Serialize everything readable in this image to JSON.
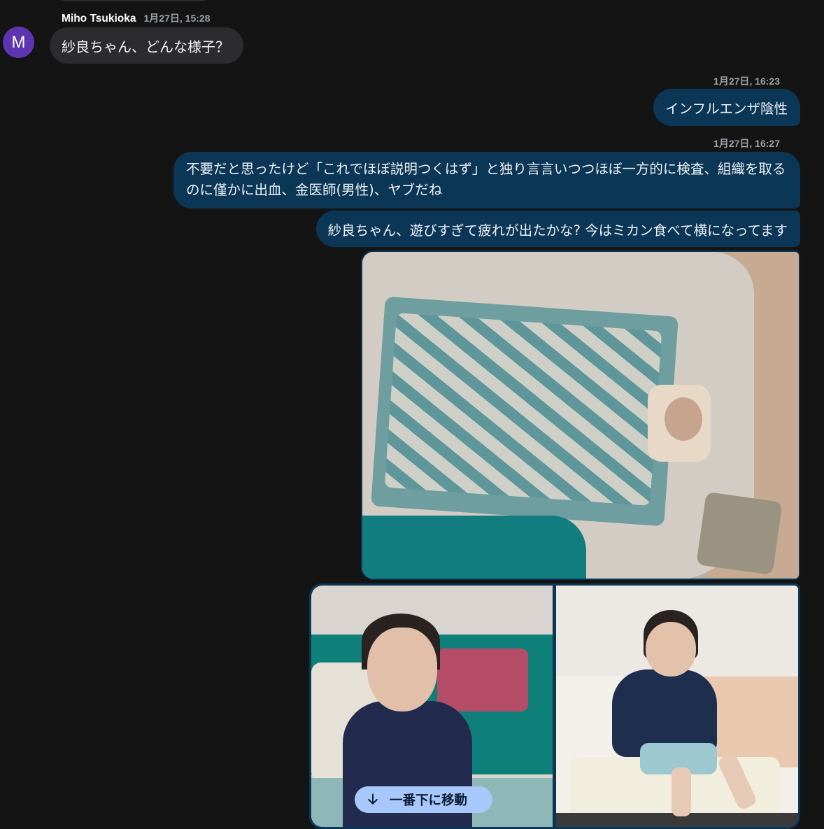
{
  "incoming": {
    "avatar_letter": "M",
    "sender": "Miho Tsukioka",
    "time": "1月27日, 15:28",
    "text": "紗良ちゃん、どんな様子？"
  },
  "outgoing": [
    {
      "time": "1月27日, 16:23",
      "text": "インフルエンザ陰性"
    },
    {
      "time": "1月27日, 16:27",
      "text": "不要だと思ったけど「これでほぼ説明つくはず」と独り言言いつつほぼ一方的に検査、組織を取るのに僅かに出血、金医師(男性)、ヤブだね"
    },
    {
      "text": "紗良ちゃん、遊びすぎて疲れが出たかな? 今はミカン食べて横になってます"
    }
  ],
  "images": [
    {
      "name": "child-sleeping-under-blanket"
    },
    {
      "name": "child-in-gap-hoodie"
    },
    {
      "name": "child-in-jacket-on-chair"
    }
  ],
  "jump_to_bottom": {
    "label": "一番下に移動",
    "icon": "arrow-down-icon"
  },
  "colors": {
    "background": "#141414",
    "incoming_bubble": "#2c2c2e",
    "outgoing_bubble": "#0b3656",
    "avatar": "#5e35b1",
    "jump_chip": "#a8c7fa"
  }
}
